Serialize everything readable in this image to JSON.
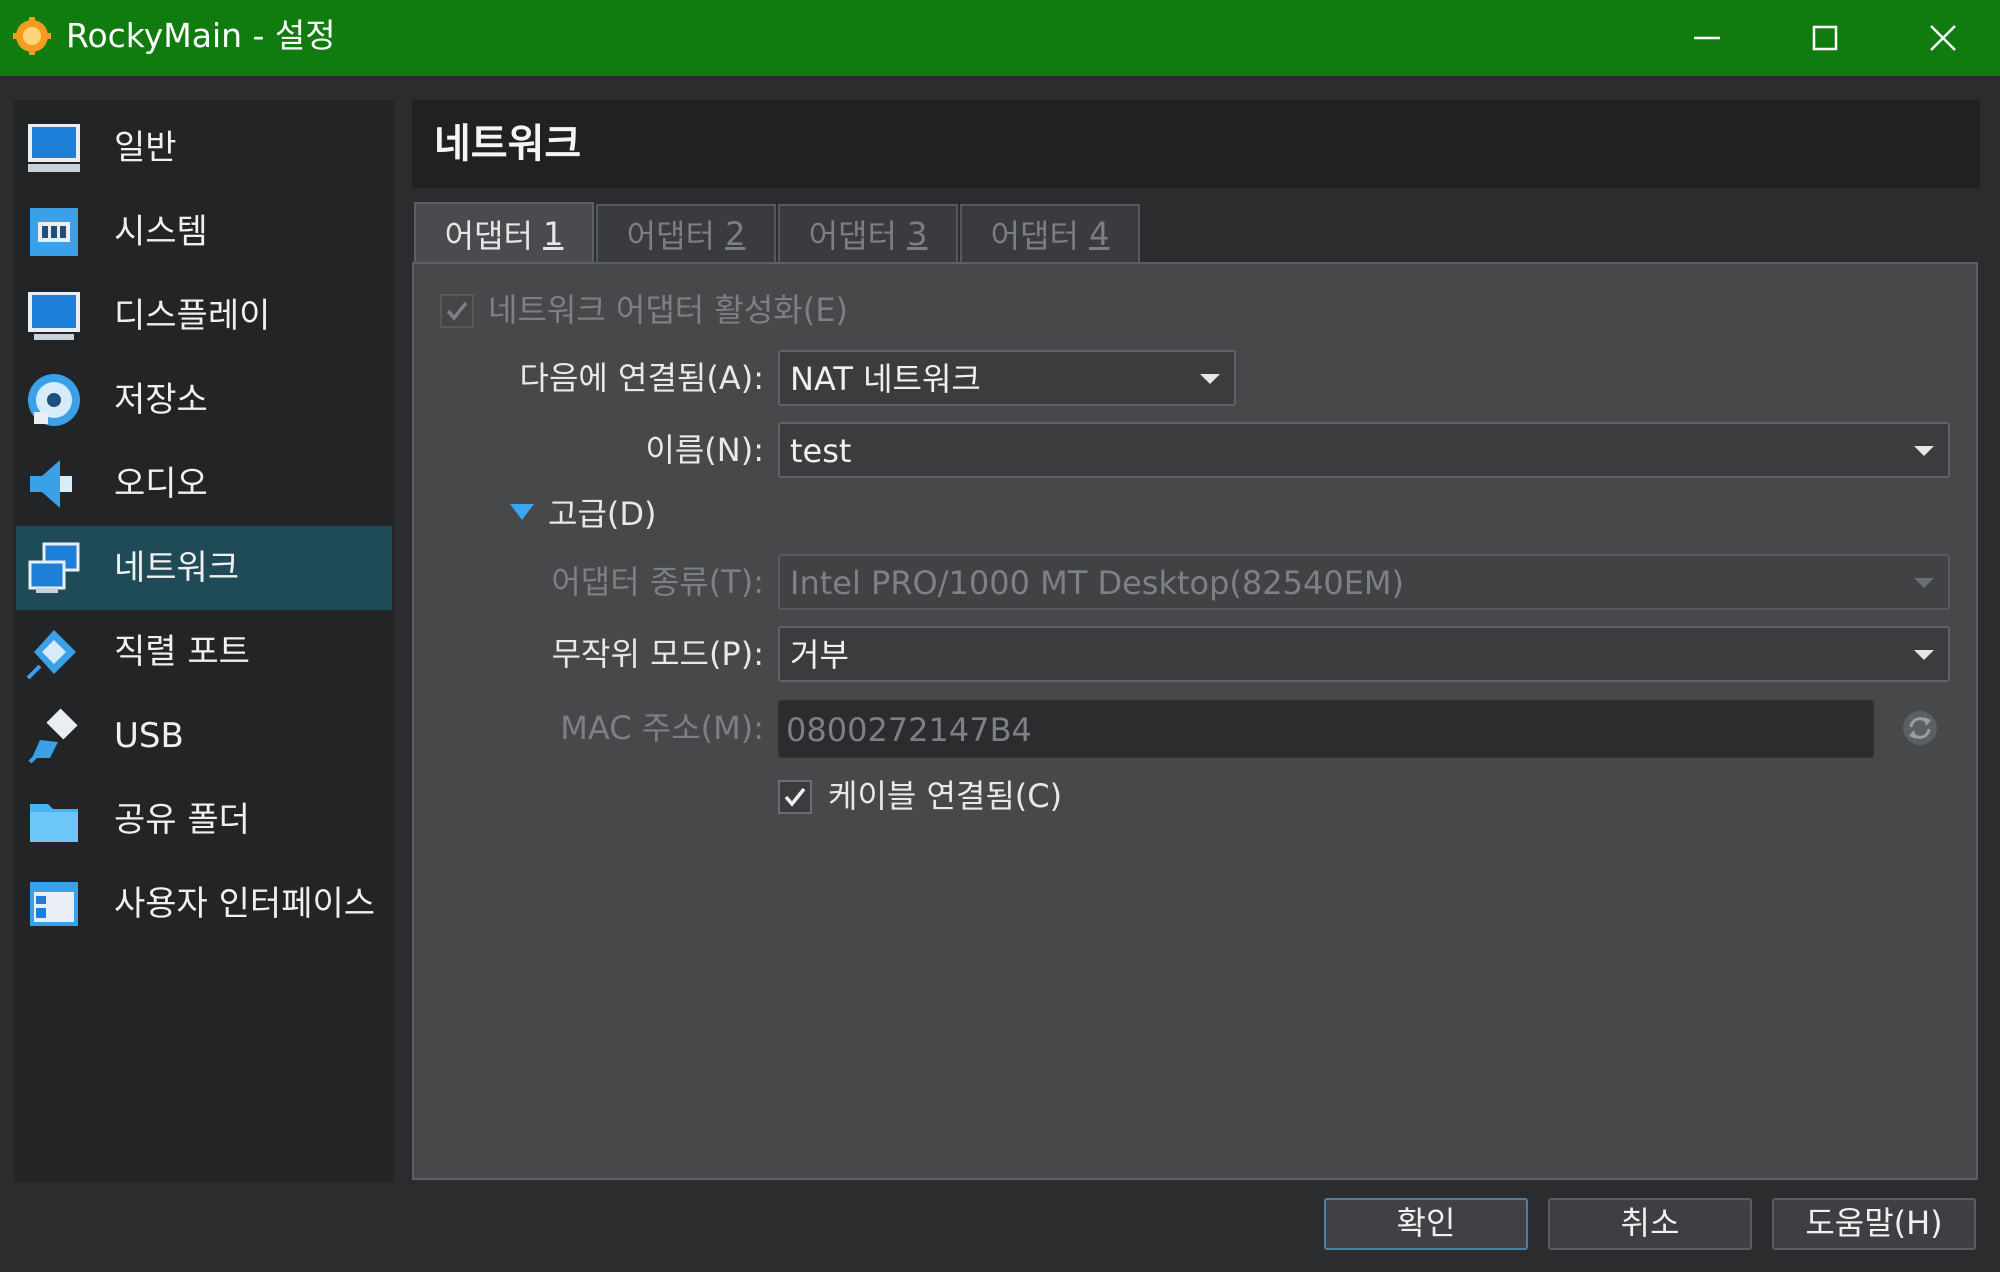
{
  "window": {
    "title": "RockyMain - 설정",
    "controls": {
      "minimize": "minimize-icon",
      "maximize": "maximize-icon",
      "close": "close-icon"
    }
  },
  "sidebar": {
    "items": [
      {
        "label": "일반",
        "icon": "monitor-icon"
      },
      {
        "label": "시스템",
        "icon": "chip-icon"
      },
      {
        "label": "디스플레이",
        "icon": "display-icon"
      },
      {
        "label": "저장소",
        "icon": "disk-icon"
      },
      {
        "label": "오디오",
        "icon": "speaker-icon"
      },
      {
        "label": "네트워크",
        "icon": "network-icon",
        "selected": true
      },
      {
        "label": "직렬 포트",
        "icon": "serial-port-icon"
      },
      {
        "label": "USB",
        "icon": "usb-icon"
      },
      {
        "label": "공유 폴더",
        "icon": "folder-icon"
      },
      {
        "label": "사용자 인터페이스",
        "icon": "ui-window-icon"
      }
    ]
  },
  "page": {
    "title": "네트워크"
  },
  "tabs": [
    {
      "prefix": "어댑터 ",
      "mnemonic": "1",
      "active": true
    },
    {
      "prefix": "어댑터 ",
      "mnemonic": "2"
    },
    {
      "prefix": "어댑터 ",
      "mnemonic": "3"
    },
    {
      "prefix": "어댑터 ",
      "mnemonic": "4"
    }
  ],
  "adapter": {
    "enable_label": "네트워크 어댑터 활성화(E)",
    "enable_checked": true,
    "attached_label": "다음에 연결됨(A):",
    "attached_value": "NAT 네트워크",
    "name_label": "이름(N):",
    "name_value": "test",
    "advanced_label": "고급(D)",
    "adapter_type_label": "어댑터 종류(T):",
    "adapter_type_value": "Intel PRO/1000 MT Desktop(82540EM)",
    "promisc_label": "무작위 모드(P):",
    "promisc_value": "거부",
    "mac_label": "MAC 주소(M):",
    "mac_value": "0800272147B4",
    "cable_label": "케이블 연결됨(C)",
    "cable_checked": true
  },
  "buttons": {
    "ok": "확인",
    "cancel": "취소",
    "help": "도움말(H)"
  },
  "colors": {
    "titlebar": "#107c10",
    "selected_item": "#1f4a57",
    "background": "#2b2c2e"
  }
}
